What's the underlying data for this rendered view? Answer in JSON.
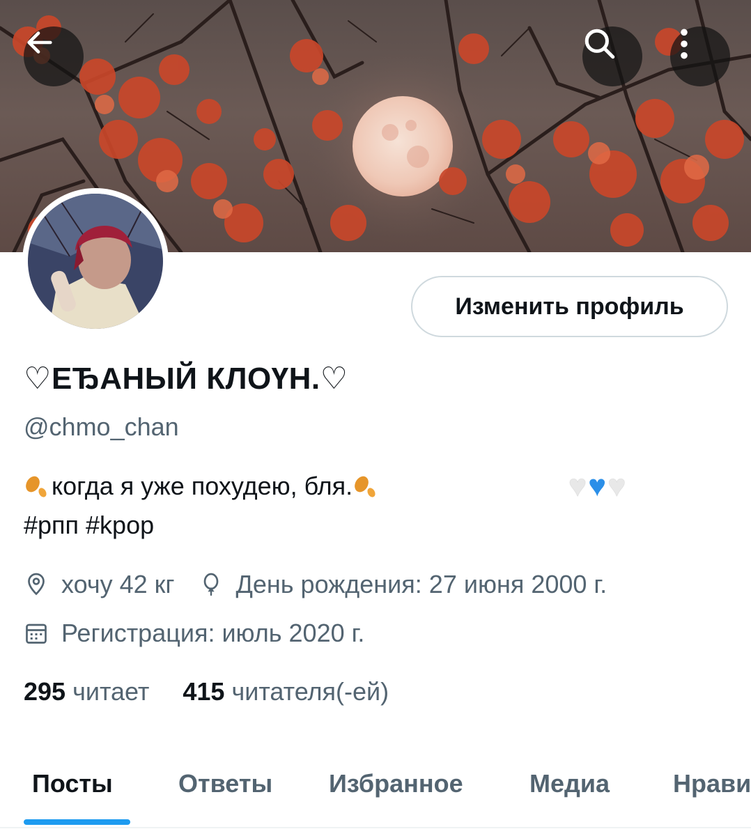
{
  "header": {
    "back_icon": "arrow-left-icon",
    "search_icon": "search-icon",
    "more_icon": "more-vertical-icon"
  },
  "profile": {
    "edit_button": "Изменить профиль",
    "display_name": "♡ЕЂАНЫЙ КЛОҮН.♡",
    "handle": "@chmo_chan",
    "bio": {
      "line1": "когда я уже похудею, бля.",
      "line2": "#рпп #kpop",
      "hearts": [
        "🤍",
        "💙",
        "🤍"
      ]
    },
    "location": "хочу 42 кг",
    "birthday": "День рождения: 27 июня 2000 г.",
    "joined": "Регистрация: июль 2020 г.",
    "following_count": "295",
    "following_label": "читает",
    "followers_count": "415",
    "followers_label": "читателя(-ей)"
  },
  "tabs": [
    {
      "label": "Посты",
      "active": true
    },
    {
      "label": "Ответы",
      "active": false
    },
    {
      "label": "Избранное",
      "active": false
    },
    {
      "label": "Медиа",
      "active": false
    },
    {
      "label": "Нрави",
      "active": false
    }
  ],
  "colors": {
    "accent": "#1d9bf0",
    "secondary_text": "#536471",
    "primary_text": "#0f1419",
    "border": "#cfd9de"
  }
}
